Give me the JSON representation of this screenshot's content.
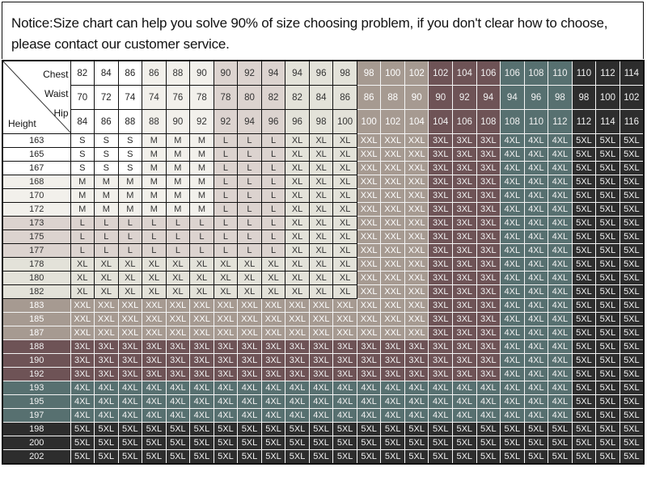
{
  "notice": {
    "text": "Notice:Size chart can help you solve 90% of size choosing problem, if you don't clear how to choose, please contact our customer service."
  },
  "table": {
    "corner_labels": {
      "chest": "Chest",
      "waist": "Waist",
      "hip": "Hip",
      "height": "Height"
    },
    "measurements": {
      "chest": [
        "82",
        "84",
        "86",
        "86",
        "88",
        "90",
        "90",
        "92",
        "94",
        "94",
        "96",
        "98",
        "98",
        "100",
        "102",
        "102",
        "104",
        "106",
        "106",
        "108",
        "110",
        "110",
        "112",
        "114"
      ],
      "waist": [
        "70",
        "72",
        "74",
        "74",
        "76",
        "78",
        "78",
        "80",
        "82",
        "82",
        "84",
        "86",
        "86",
        "88",
        "90",
        "90",
        "92",
        "94",
        "94",
        "96",
        "98",
        "98",
        "100",
        "102"
      ],
      "hip": [
        "84",
        "86",
        "88",
        "88",
        "90",
        "92",
        "92",
        "94",
        "96",
        "96",
        "98",
        "100",
        "100",
        "102",
        "104",
        "104",
        "106",
        "108",
        "108",
        "110",
        "112",
        "112",
        "114",
        "116"
      ]
    },
    "size_levels": [
      "S",
      "M",
      "L",
      "XL",
      "XXL",
      "3XL",
      "4XL",
      "5XL"
    ],
    "colors": {
      "S": "#ffffff",
      "M": "#f2f0eb",
      "L": "#dcd3cf",
      "XL": "#e3e2d9",
      "XXL": "#a69a91",
      "3XL": "#6e5356",
      "4XL": "#577070",
      "5XL": "#2d2d2d"
    },
    "rows": [
      {
        "height": "163",
        "sizes": [
          "S",
          "S",
          "S",
          "M",
          "M",
          "M",
          "L",
          "L",
          "L",
          "XL",
          "XL",
          "XL",
          "XXL",
          "XXL",
          "XXL",
          "3XL",
          "3XL",
          "3XL",
          "4XL",
          "4XL",
          "4XL",
          "5XL",
          "5XL",
          "5XL"
        ]
      },
      {
        "height": "165",
        "sizes": [
          "S",
          "S",
          "S",
          "M",
          "M",
          "M",
          "L",
          "L",
          "L",
          "XL",
          "XL",
          "XL",
          "XXL",
          "XXL",
          "XXL",
          "3XL",
          "3XL",
          "3XL",
          "4XL",
          "4XL",
          "4XL",
          "5XL",
          "5XL",
          "5XL"
        ]
      },
      {
        "height": "167",
        "sizes": [
          "S",
          "S",
          "S",
          "M",
          "M",
          "M",
          "L",
          "L",
          "L",
          "XL",
          "XL",
          "XL",
          "XXL",
          "XXL",
          "XXL",
          "3XL",
          "3XL",
          "3XL",
          "4XL",
          "4XL",
          "4XL",
          "5XL",
          "5XL",
          "5XL"
        ]
      },
      {
        "height": "168",
        "sizes": [
          "M",
          "M",
          "M",
          "M",
          "M",
          "M",
          "L",
          "L",
          "L",
          "XL",
          "XL",
          "XL",
          "XXL",
          "XXL",
          "XXL",
          "3XL",
          "3XL",
          "3XL",
          "4XL",
          "4XL",
          "4XL",
          "5XL",
          "5XL",
          "5XL"
        ]
      },
      {
        "height": "170",
        "sizes": [
          "M",
          "M",
          "M",
          "M",
          "M",
          "M",
          "L",
          "L",
          "L",
          "XL",
          "XL",
          "XL",
          "XXL",
          "XXL",
          "XXL",
          "3XL",
          "3XL",
          "3XL",
          "4XL",
          "4XL",
          "4XL",
          "5XL",
          "5XL",
          "5XL"
        ]
      },
      {
        "height": "172",
        "sizes": [
          "M",
          "M",
          "M",
          "M",
          "M",
          "M",
          "L",
          "L",
          "L",
          "XL",
          "XL",
          "XL",
          "XXL",
          "XXL",
          "XXL",
          "3XL",
          "3XL",
          "3XL",
          "4XL",
          "4XL",
          "4XL",
          "5XL",
          "5XL",
          "5XL"
        ]
      },
      {
        "height": "173",
        "sizes": [
          "L",
          "L",
          "L",
          "L",
          "L",
          "L",
          "L",
          "L",
          "L",
          "XL",
          "XL",
          "XL",
          "XXL",
          "XXL",
          "XXL",
          "3XL",
          "3XL",
          "3XL",
          "4XL",
          "4XL",
          "4XL",
          "5XL",
          "5XL",
          "5XL"
        ]
      },
      {
        "height": "175",
        "sizes": [
          "L",
          "L",
          "L",
          "L",
          "L",
          "L",
          "L",
          "L",
          "L",
          "XL",
          "XL",
          "XL",
          "XXL",
          "XXL",
          "XXL",
          "3XL",
          "3XL",
          "3XL",
          "4XL",
          "4XL",
          "4XL",
          "5XL",
          "5XL",
          "5XL"
        ]
      },
      {
        "height": "177",
        "sizes": [
          "L",
          "L",
          "L",
          "L",
          "L",
          "L",
          "L",
          "L",
          "L",
          "XL",
          "XL",
          "XL",
          "XXL",
          "XXL",
          "XXL",
          "3XL",
          "3XL",
          "3XL",
          "4XL",
          "4XL",
          "4XL",
          "5XL",
          "5XL",
          "5XL"
        ]
      },
      {
        "height": "178",
        "sizes": [
          "XL",
          "XL",
          "XL",
          "XL",
          "XL",
          "XL",
          "XL",
          "XL",
          "XL",
          "XL",
          "XL",
          "XL",
          "XXL",
          "XXL",
          "XXL",
          "3XL",
          "3XL",
          "3XL",
          "4XL",
          "4XL",
          "4XL",
          "5XL",
          "5XL",
          "5XL"
        ]
      },
      {
        "height": "180",
        "sizes": [
          "XL",
          "XL",
          "XL",
          "XL",
          "XL",
          "XL",
          "XL",
          "XL",
          "XL",
          "XL",
          "XL",
          "XL",
          "XXL",
          "XXL",
          "XXL",
          "3XL",
          "3XL",
          "3XL",
          "4XL",
          "4XL",
          "4XL",
          "5XL",
          "5XL",
          "5XL"
        ]
      },
      {
        "height": "182",
        "sizes": [
          "XL",
          "XL",
          "XL",
          "XL",
          "XL",
          "XL",
          "XL",
          "XL",
          "XL",
          "XL",
          "XL",
          "XL",
          "XXL",
          "XXL",
          "XXL",
          "3XL",
          "3XL",
          "3XL",
          "4XL",
          "4XL",
          "4XL",
          "5XL",
          "5XL",
          "5XL"
        ]
      },
      {
        "height": "183",
        "sizes": [
          "XXL",
          "XXL",
          "XXL",
          "XXL",
          "XXL",
          "XXL",
          "XXL",
          "XXL",
          "XXL",
          "XXL",
          "XXL",
          "XXL",
          "XXL",
          "XXL",
          "XXL",
          "3XL",
          "3XL",
          "3XL",
          "4XL",
          "4XL",
          "4XL",
          "5XL",
          "5XL",
          "5XL"
        ]
      },
      {
        "height": "185",
        "sizes": [
          "XXL",
          "XXL",
          "XXL",
          "XXL",
          "XXL",
          "XXL",
          "XXL",
          "XXL",
          "XXL",
          "XXL",
          "XXL",
          "XXL",
          "XXL",
          "XXL",
          "XXL",
          "3XL",
          "3XL",
          "3XL",
          "4XL",
          "4XL",
          "4XL",
          "5XL",
          "5XL",
          "5XL"
        ]
      },
      {
        "height": "187",
        "sizes": [
          "XXL",
          "XXL",
          "XXL",
          "XXL",
          "XXL",
          "XXL",
          "XXL",
          "XXL",
          "XXL",
          "XXL",
          "XXL",
          "XXL",
          "XXL",
          "XXL",
          "XXL",
          "3XL",
          "3XL",
          "3XL",
          "4XL",
          "4XL",
          "4XL",
          "5XL",
          "5XL",
          "5XL"
        ]
      },
      {
        "height": "188",
        "sizes": [
          "3XL",
          "3XL",
          "3XL",
          "3XL",
          "3XL",
          "3XL",
          "3XL",
          "3XL",
          "3XL",
          "3XL",
          "3XL",
          "3XL",
          "3XL",
          "3XL",
          "3XL",
          "3XL",
          "3XL",
          "3XL",
          "4XL",
          "4XL",
          "4XL",
          "5XL",
          "5XL",
          "5XL"
        ]
      },
      {
        "height": "190",
        "sizes": [
          "3XL",
          "3XL",
          "3XL",
          "3XL",
          "3XL",
          "3XL",
          "3XL",
          "3XL",
          "3XL",
          "3XL",
          "3XL",
          "3XL",
          "3XL",
          "3XL",
          "3XL",
          "3XL",
          "3XL",
          "3XL",
          "4XL",
          "4XL",
          "4XL",
          "5XL",
          "5XL",
          "5XL"
        ]
      },
      {
        "height": "192",
        "sizes": [
          "3XL",
          "3XL",
          "3XL",
          "3XL",
          "3XL",
          "3XL",
          "3XL",
          "3XL",
          "3XL",
          "3XL",
          "3XL",
          "3XL",
          "3XL",
          "3XL",
          "3XL",
          "3XL",
          "3XL",
          "3XL",
          "4XL",
          "4XL",
          "4XL",
          "5XL",
          "5XL",
          "5XL"
        ]
      },
      {
        "height": "193",
        "sizes": [
          "4XL",
          "4XL",
          "4XL",
          "4XL",
          "4XL",
          "4XL",
          "4XL",
          "4XL",
          "4XL",
          "4XL",
          "4XL",
          "4XL",
          "4XL",
          "4XL",
          "4XL",
          "4XL",
          "4XL",
          "4XL",
          "4XL",
          "4XL",
          "4XL",
          "5XL",
          "5XL",
          "5XL"
        ]
      },
      {
        "height": "195",
        "sizes": [
          "4XL",
          "4XL",
          "4XL",
          "4XL",
          "4XL",
          "4XL",
          "4XL",
          "4XL",
          "4XL",
          "4XL",
          "4XL",
          "4XL",
          "4XL",
          "4XL",
          "4XL",
          "4XL",
          "4XL",
          "4XL",
          "4XL",
          "4XL",
          "4XL",
          "5XL",
          "5XL",
          "5XL"
        ]
      },
      {
        "height": "197",
        "sizes": [
          "4XL",
          "4XL",
          "4XL",
          "4XL",
          "4XL",
          "4XL",
          "4XL",
          "4XL",
          "4XL",
          "4XL",
          "4XL",
          "4XL",
          "4XL",
          "4XL",
          "4XL",
          "4XL",
          "4XL",
          "4XL",
          "4XL",
          "4XL",
          "4XL",
          "5XL",
          "5XL",
          "5XL"
        ]
      },
      {
        "height": "198",
        "sizes": [
          "5XL",
          "5XL",
          "5XL",
          "5XL",
          "5XL",
          "5XL",
          "5XL",
          "5XL",
          "5XL",
          "5XL",
          "5XL",
          "5XL",
          "5XL",
          "5XL",
          "5XL",
          "5XL",
          "5XL",
          "5XL",
          "5XL",
          "5XL",
          "5XL",
          "5XL",
          "5XL",
          "5XL"
        ]
      },
      {
        "height": "200",
        "sizes": [
          "5XL",
          "5XL",
          "5XL",
          "5XL",
          "5XL",
          "5XL",
          "5XL",
          "5XL",
          "5XL",
          "5XL",
          "5XL",
          "5XL",
          "5XL",
          "5XL",
          "5XL",
          "5XL",
          "5XL",
          "5XL",
          "5XL",
          "5XL",
          "5XL",
          "5XL",
          "5XL",
          "5XL"
        ]
      },
      {
        "height": "202",
        "sizes": [
          "5XL",
          "5XL",
          "5XL",
          "5XL",
          "5XL",
          "5XL",
          "5XL",
          "5XL",
          "5XL",
          "5XL",
          "5XL",
          "5XL",
          "5XL",
          "5XL",
          "5XL",
          "5XL",
          "5XL",
          "5XL",
          "5XL",
          "5XL",
          "5XL",
          "5XL",
          "5XL",
          "5XL"
        ]
      }
    ]
  }
}
